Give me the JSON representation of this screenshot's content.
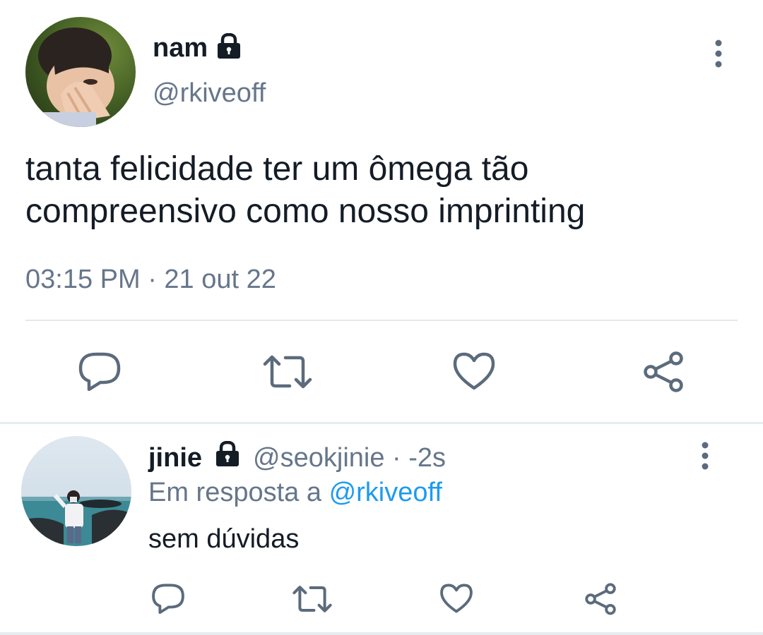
{
  "tweet": {
    "author": {
      "display_name": "nam",
      "handle": "@rkiveoff",
      "protected": true
    },
    "text_line1": "tanta felicidade ter um ômega tão",
    "text_line2": "compreensivo como nosso imprinting",
    "timestamp": "03:15 PM · 21 out 22",
    "actions": [
      "reply-icon",
      "retweet-icon",
      "like-icon",
      "share-icon"
    ]
  },
  "reply": {
    "author": {
      "display_name": "jinie",
      "handle": "@seokjinie",
      "protected": true
    },
    "time": " · -2s",
    "reply_prefix": "Em resposta a",
    "reply_to": "@rkiveoff",
    "text": "sem dúvidas",
    "actions": [
      "reply-icon",
      "retweet-icon",
      "like-icon",
      "share-icon"
    ]
  },
  "colors": {
    "text": "#141c26",
    "muted": "#66768a",
    "link": "#1d9bf0",
    "divider": "#e3e8ec"
  }
}
